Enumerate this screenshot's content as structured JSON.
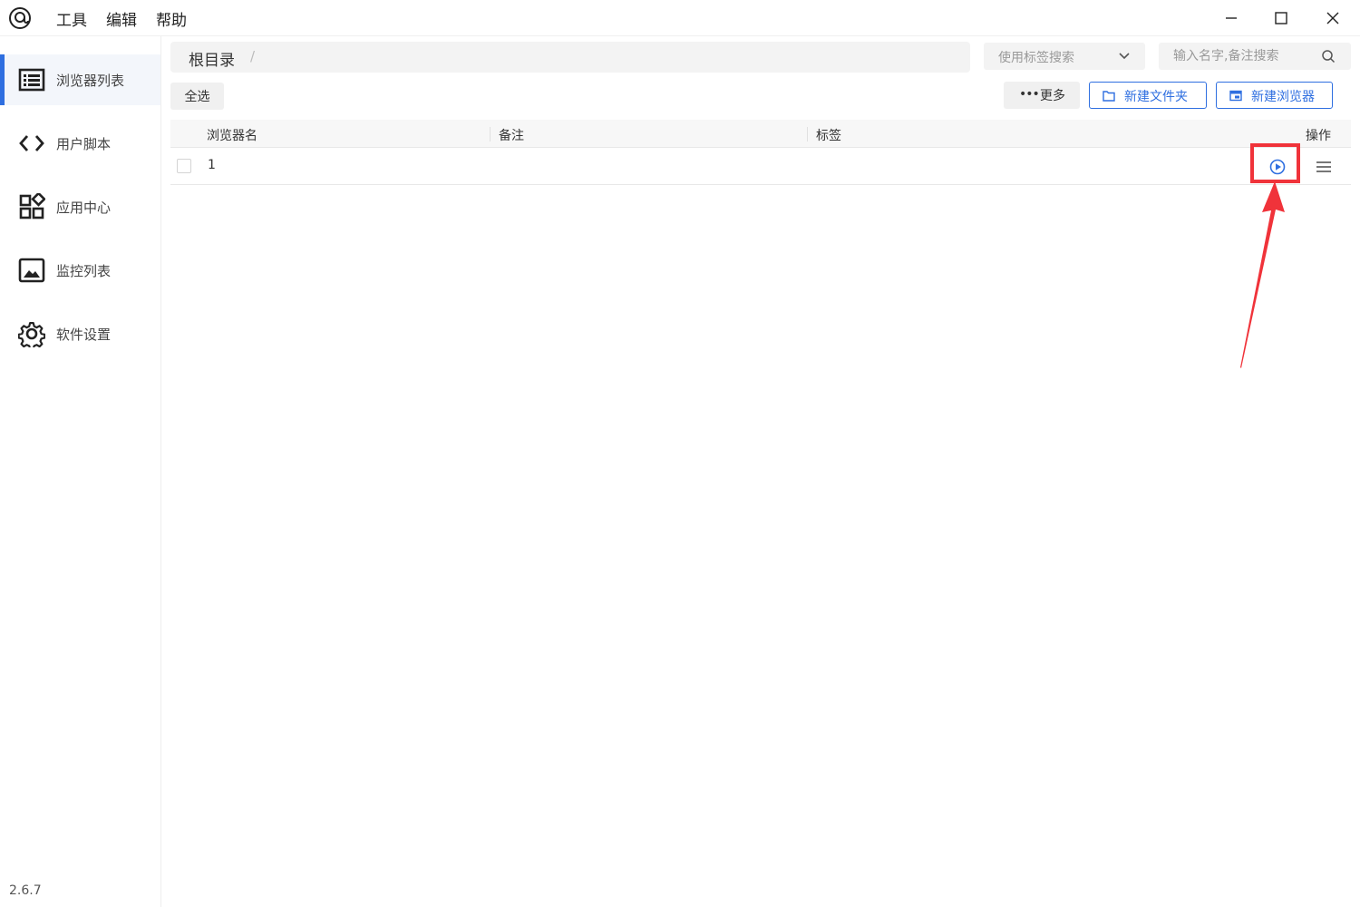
{
  "menu": {
    "tools": "工具",
    "edit": "编辑",
    "help": "帮助"
  },
  "sidebar": {
    "items": [
      {
        "label": "浏览器列表",
        "icon": "list-icon",
        "active": true
      },
      {
        "label": "用户脚本",
        "icon": "code-icon",
        "active": false
      },
      {
        "label": "应用中心",
        "icon": "apps-icon",
        "active": false
      },
      {
        "label": "监控列表",
        "icon": "image-icon",
        "active": false
      },
      {
        "label": "软件设置",
        "icon": "gear-icon",
        "active": false
      }
    ],
    "version": "2.6.7"
  },
  "breadcrumb": {
    "root": "根目录",
    "separator": "/"
  },
  "filters": {
    "tag_placeholder": "使用标签搜索",
    "search_placeholder": "输入名字,备注搜索"
  },
  "toolbar": {
    "select_all": "全选",
    "more": "更多",
    "new_folder": "新建文件夹",
    "new_browser": "新建浏览器"
  },
  "table": {
    "columns": [
      "浏览器名",
      "备注",
      "标签",
      "操作"
    ],
    "rows": [
      {
        "name": "1",
        "note": "",
        "tags": ""
      }
    ]
  },
  "colors": {
    "accent": "#2f6fe0",
    "annotation": "#f0333a"
  }
}
